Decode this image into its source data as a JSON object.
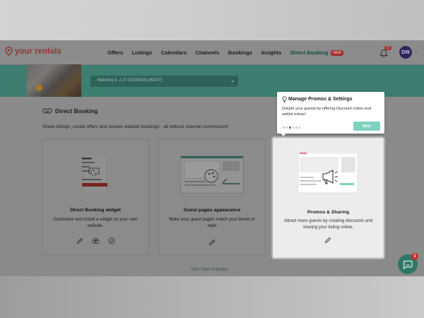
{
  "brand": {
    "name": "your rentals"
  },
  "nav": {
    "items": [
      "Offers",
      "Listings",
      "Calendars",
      "Channels",
      "Bookings",
      "Insights"
    ],
    "active_label": "Direct Booking",
    "new_badge": "NEW",
    "bell_count": "12",
    "avatar_initials": "DW"
  },
  "property_selector": {
    "value": "Billedvej 8, 2.3/ 01509039 (49037)"
  },
  "section": {
    "title": "Direct Booking",
    "subtitle": "Share listings, create offers and receive website bookings - all without channel commission!"
  },
  "cards": [
    {
      "title": "Direct Booking widget",
      "description": "Customise and install a widget on your own website."
    },
    {
      "title": "Guest pages appearance",
      "description": "Make your guest pages match your brand or style"
    },
    {
      "title": "Promos & Sharing",
      "description": "Attract more guests by creating discounts and sharing your listing online."
    }
  ],
  "see_how": "See how it works",
  "tour": {
    "title": "Manage Promos & Settings",
    "body": "Delight your guests by offering Discount codes and added extras!",
    "next_label": "Next",
    "steps_total": 6,
    "step_current": 3
  },
  "chat": {
    "unread": "1"
  },
  "colors": {
    "brand": "#d13f3c",
    "teal": "#6fd6bf",
    "accent_dark": "#2f7768"
  }
}
